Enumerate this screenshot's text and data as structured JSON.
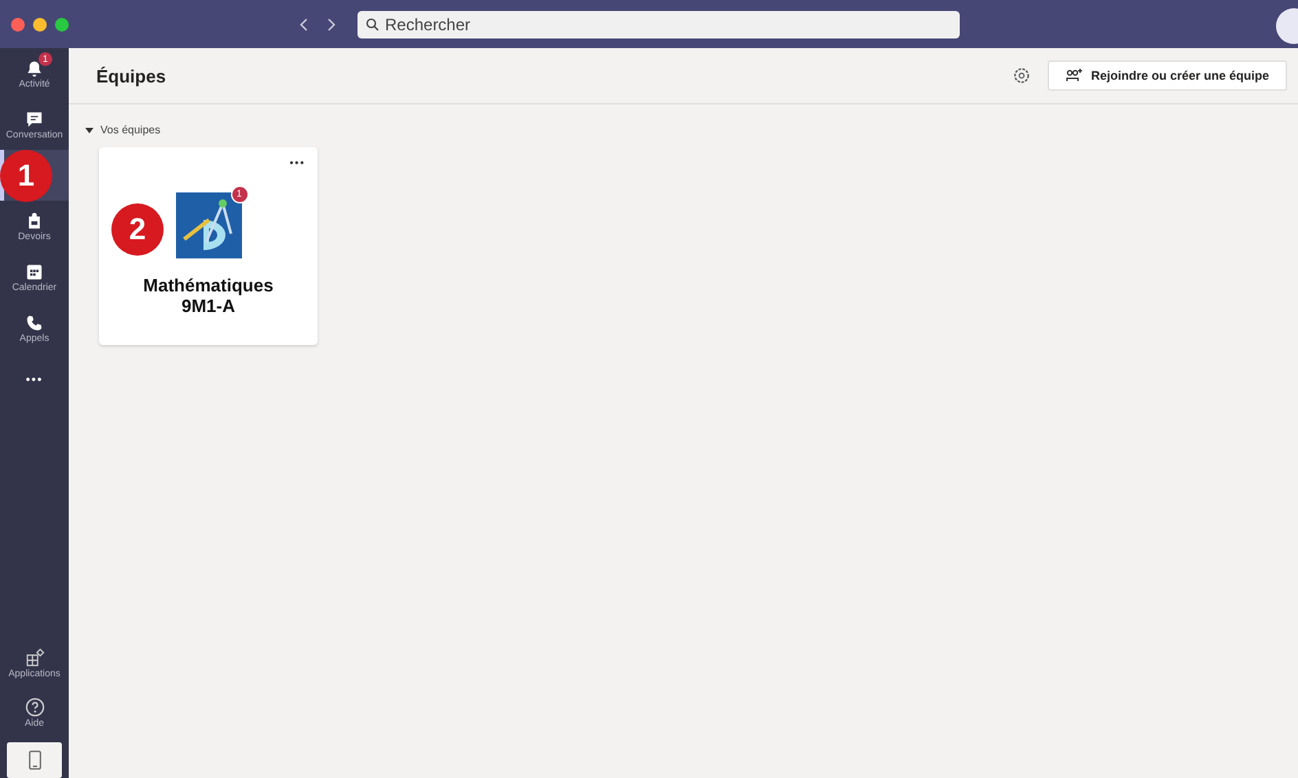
{
  "top_bar": {
    "search": {
      "placeholder": "Rechercher"
    }
  },
  "rail": {
    "items": [
      {
        "kind": "bell",
        "label": "Activité",
        "badge": "1",
        "selected": false
      },
      {
        "kind": "chat",
        "label": "Conversation",
        "selected": false
      },
      {
        "kind": "teams",
        "selected": true,
        "callout": "1"
      },
      {
        "kind": "bag",
        "label": "Devoirs",
        "selected": false
      },
      {
        "kind": "calendar",
        "label": "Calendrier",
        "selected": false
      },
      {
        "kind": "phone",
        "label": "Appels",
        "selected": false
      },
      {
        "kind": "more",
        "label": "•••",
        "selected": false
      }
    ],
    "bottom": [
      {
        "kind": "apps",
        "label": "Applications"
      },
      {
        "kind": "help",
        "label": "Aide"
      }
    ]
  },
  "header": {
    "title": "Équipes",
    "join_button": "Rejoindre ou créer une équipe"
  },
  "section": {
    "label": "Vos équipes",
    "expanded": true
  },
  "teams": [
    {
      "name": "Mathématiques\n9M1-A",
      "badge": "1",
      "more": "•••",
      "callout": "2"
    }
  ]
}
